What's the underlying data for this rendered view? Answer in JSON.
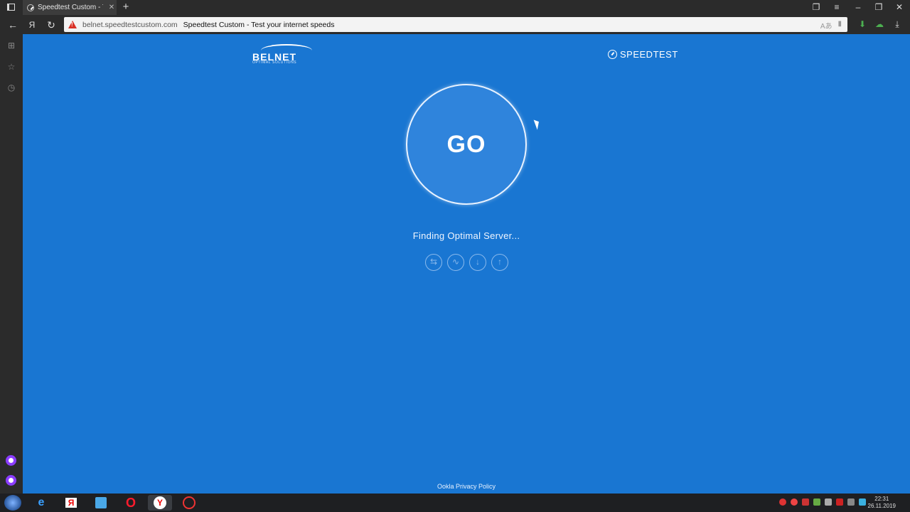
{
  "browser": {
    "tab_title": "Speedtest Custom - Test",
    "url_domain": "belnet.speedtestcustom.com",
    "page_title": "Speedtest Custom - Test your internet speeds"
  },
  "page": {
    "logo_text": "BELNET",
    "logo_subtext": "OPTIMAL SOLUTIONS",
    "brand_label": "SPEEDTEST",
    "go_label": "GO",
    "status_text": "Finding Optimal Server...",
    "steps": [
      {
        "icon": "ping-icon",
        "glyph": "⇆"
      },
      {
        "icon": "jitter-icon",
        "glyph": "∿"
      },
      {
        "icon": "download-icon",
        "glyph": "↓"
      },
      {
        "icon": "upload-icon",
        "glyph": "↑"
      }
    ],
    "privacy_link": "Ookla Privacy Policy"
  },
  "taskbar": {
    "clock_time": "22:31",
    "clock_date": "26.11.2019"
  },
  "colors": {
    "page_bg": "#1976d2",
    "go_bg": "#2f84dc",
    "chrome_bg": "#2b2b2b"
  }
}
